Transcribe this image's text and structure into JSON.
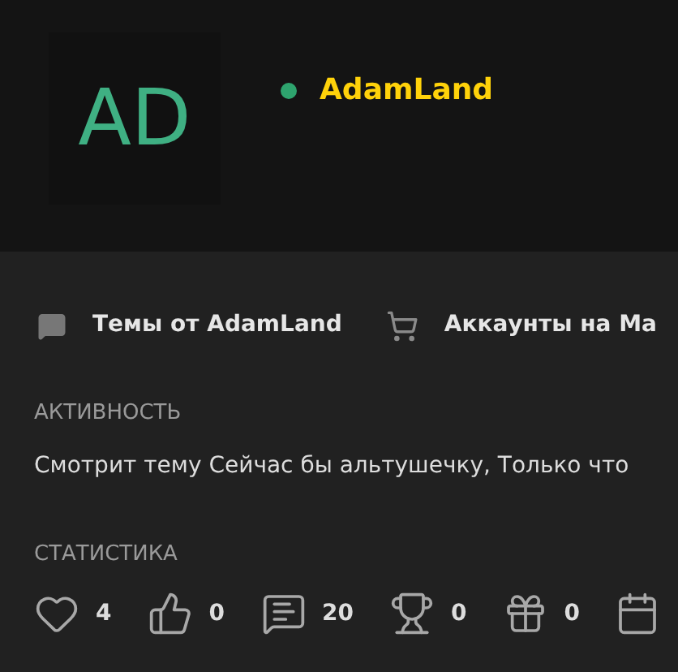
{
  "profile": {
    "avatar_initials": "AD",
    "online": true,
    "username": "AdamLand"
  },
  "links": [
    {
      "kind": "topics",
      "label": "Темы от AdamLand"
    },
    {
      "kind": "market",
      "label": "Аккаунты на Ма"
    }
  ],
  "activity": {
    "heading": "АКТИВНОСТЬ",
    "text": "Смотрит тему Сейчас бы альтушечку, Только что"
  },
  "statistics": {
    "heading": "СТАТИСТИКА",
    "items": [
      {
        "kind": "likes",
        "value": "4"
      },
      {
        "kind": "thumbs",
        "value": "0"
      },
      {
        "kind": "messages",
        "value": "20"
      },
      {
        "kind": "trophies",
        "value": "0"
      },
      {
        "kind": "gifts",
        "value": "0"
      },
      {
        "kind": "calendar"
      }
    ]
  }
}
